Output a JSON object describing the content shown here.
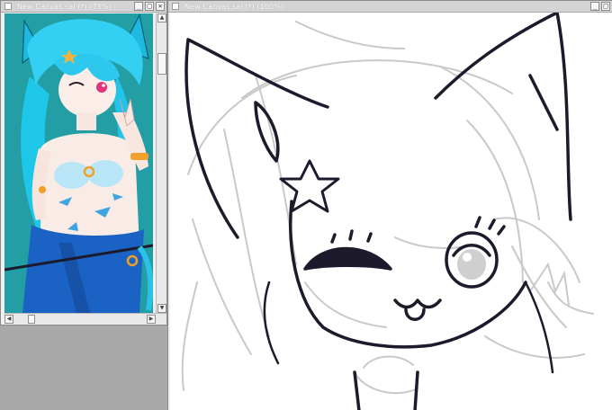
{
  "app": {
    "workspace_color": "#a9a9a9",
    "accent": "#25a1a7"
  },
  "navigator_window": {
    "title": "New Canvas.sai (*) (75%)",
    "buttons": [
      "minimize-icon",
      "maximize-icon",
      "close-icon"
    ]
  },
  "main_window": {
    "title": "New Canvas.sai (*) (100%)",
    "buttons": [
      "minimize-icon",
      "maximize-icon",
      "close-icon"
    ]
  },
  "icons": {
    "minimize": "_",
    "maximize": "□",
    "close": "✕",
    "arrow_up": "▲",
    "arrow_down": "▼",
    "arrow_left": "◀",
    "arrow_right": "▶"
  }
}
